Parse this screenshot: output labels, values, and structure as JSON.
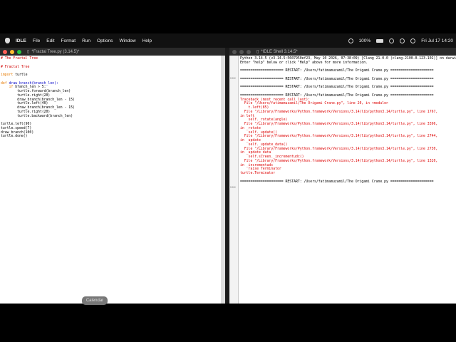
{
  "menubar": {
    "app": "IDLE",
    "items": [
      "File",
      "Edit",
      "Format",
      "Run",
      "Options",
      "Window",
      "Help"
    ],
    "battery": "100%",
    "clock": "Fri Jul 17  14:20"
  },
  "editor": {
    "title": "*Fractal Tree.py (3.14.5)*",
    "lines": [
      "# The Fractal Tree",
      "",
      "# Fractal Tree",
      "",
      "import turtle",
      "",
      "def draw_branch(branch_len):",
      "    if branch_len > 5:",
      "        turtle.forward(branch_len)",
      "        turtle.right(20)",
      "        draw_branch(branch_len - 15)",
      "        turtle.left(40)",
      "        draw_branch(branch_len - 15)",
      "        turtle.right(20)",
      "        turtle.backward(branch_len)",
      "",
      "turtle.left(90)",
      "turtle.speed(7)",
      "draw_branch(100)",
      "turtle.done()"
    ]
  },
  "shell": {
    "title": "*IDLE Shell 3.14.5*",
    "gutter": [
      ">>>",
      ">>>"
    ],
    "banner": "Python 3.14.5 (v3.14.5:5607950ef23, May 10 2026, 07:38:09) [Clang 21.0.0 (clang-2100.0.123.102)] on darwin\nEnter \"help\" below or click \"Help\" above for more information.",
    "restarts": [
      "===================== RESTART: /Users/fatimamuzamil/The Origami Crane.py =====================",
      "===================== RESTART: /Users/fatimamuzamil/The Origami Crane.py =====================",
      "===================== RESTART: /Users/fatimamuzamil/The Origami Crane.py =====================",
      "===================== RESTART: /Users/fatimamuzamil/The Origami Crane.py ====================="
    ],
    "traceback": "Traceback (most recent call last):\n  File \"/Users/fatimamuzamil/The Origami Crane.py\", line 20, in <module>\n    t.left(85)\n  File \"/Library/Frameworks/Python.framework/Versions/3.14/lib/python3.14/turtle.py\", line 1767,\nin left\n    self._rotate(angle)\n  File \"/Library/Frameworks/Python.framework/Versions/3.14/lib/python3.14/turtle.py\", line 3396,\nin _rotate\n    self._update()\n  File \"/Library/Frameworks/Python.framework/Versions/3.14/lib/python3.14/turtle.py\", line 2744,\nin _update\n    self._update_data()\n  File \"/Library/Frameworks/Python.framework/Versions/3.14/lib/python3.14/turtle.py\", line 2730,\nin _update_data\n    self.screen._incrementudc()\n  File \"/Library/Frameworks/Python.framework/Versions/3.14/lib/python3.14/turtle.py\", line 1320,\nin _incrementudc\n    raise Terminator\nturtle.Terminator",
    "last_restart": "===================== RESTART: /Users/fatimamuzamil/The Origami Crane.py ====================="
  },
  "dock": {
    "tooltip": "Calendar"
  },
  "colors": {
    "comment": "#d00000",
    "keyword": "#e67a00",
    "def_name": "#0000c8",
    "error": "#d00000"
  }
}
